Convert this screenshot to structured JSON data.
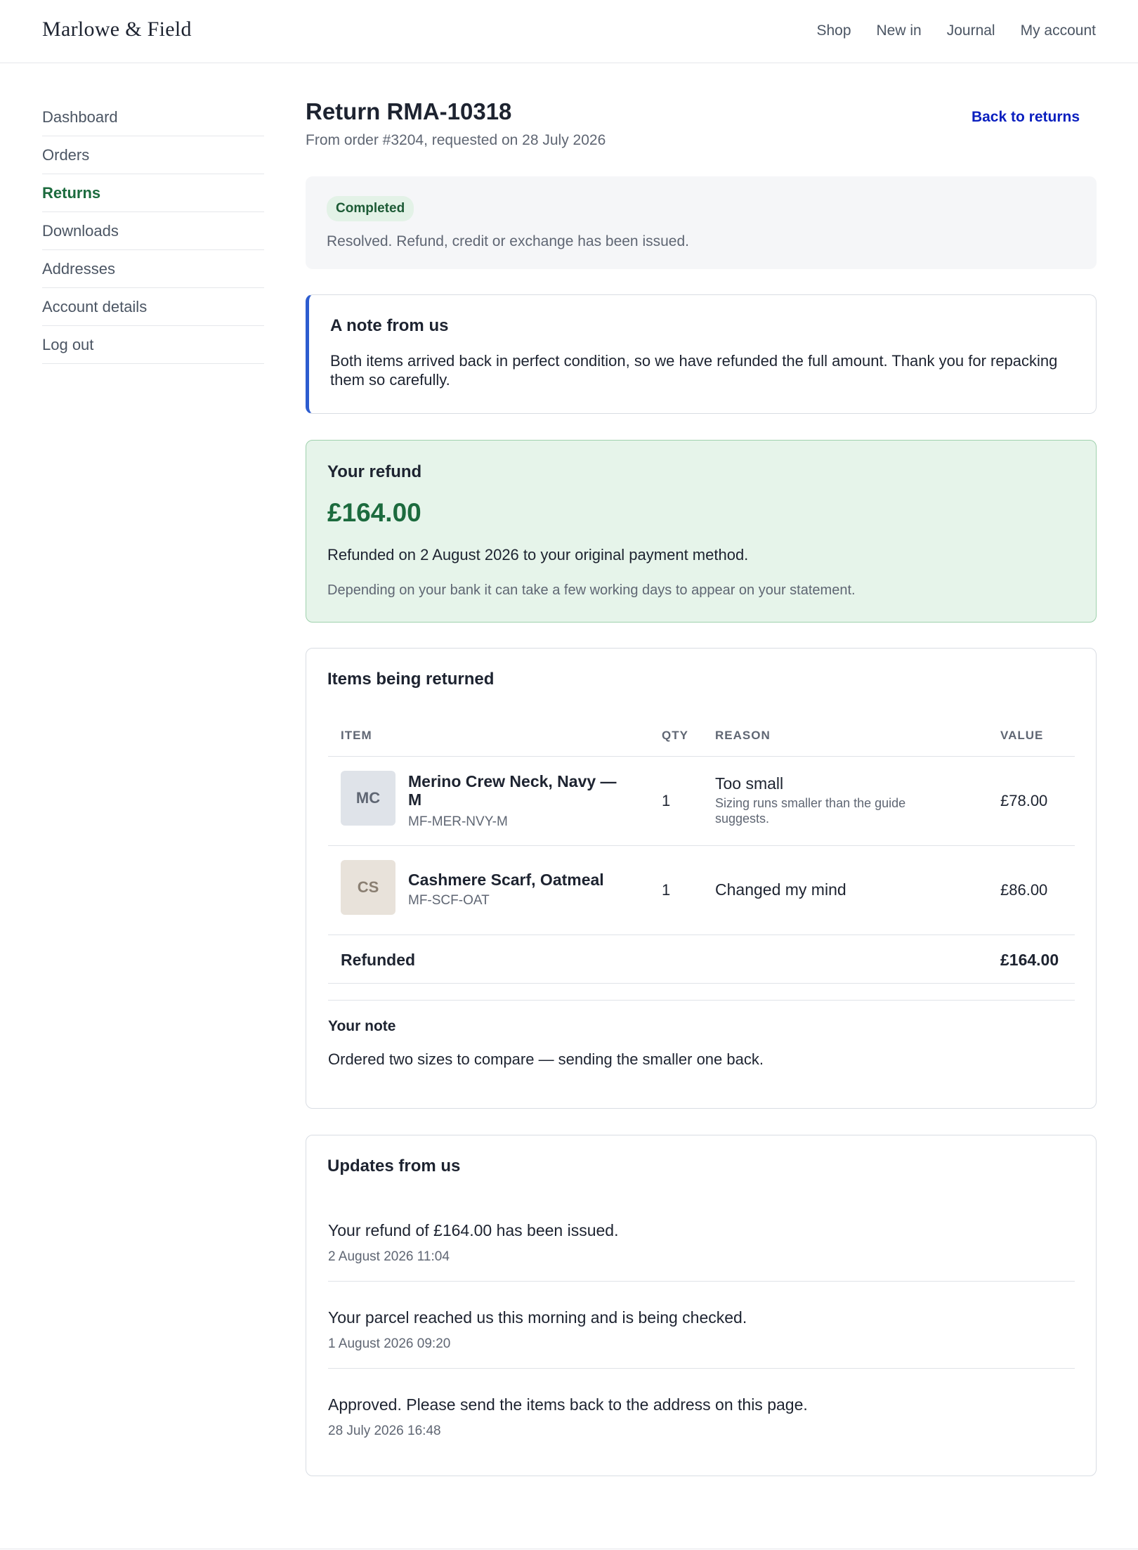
{
  "header": {
    "brand": "Marlowe & Field",
    "nav": [
      "Shop",
      "New in",
      "Journal",
      "My account"
    ]
  },
  "sidebar": {
    "items": [
      {
        "label": "Dashboard",
        "active": false
      },
      {
        "label": "Orders",
        "active": false
      },
      {
        "label": "Returns",
        "active": true
      },
      {
        "label": "Downloads",
        "active": false
      },
      {
        "label": "Addresses",
        "active": false
      },
      {
        "label": "Account details",
        "active": false
      },
      {
        "label": "Log out",
        "active": false
      }
    ]
  },
  "page": {
    "title": "Return RMA-10318",
    "subtitle": "From order #3204, requested on 28 July 2026",
    "back_label": "Back to returns"
  },
  "status": {
    "badge": "Completed",
    "text": "Resolved. Refund, credit or exchange has been issued.",
    "colors": {
      "badge_bg": "#e3f2e7",
      "badge_text": "#1c5a35"
    }
  },
  "note": {
    "title": "A note from us",
    "body": "Both items arrived back in perfect condition, so we have refunded the full amount. Thank you for repacking them so carefully."
  },
  "refund": {
    "title": "Your refund",
    "amount": "£164.00",
    "line": "Refunded on 2 August 2026 to your original payment method.",
    "hint": "Depending on your bank it can take a few working days to appear on your statement."
  },
  "items": {
    "title": "Items being returned",
    "columns": [
      "ITEM",
      "QTY",
      "REASON",
      "VALUE"
    ],
    "rows": [
      {
        "thumb": "MC",
        "name": "Merino Crew Neck, Navy — M",
        "sku": "MF-MER-NVY-M",
        "qty": "1",
        "reason": "Too small",
        "reason_detail": "Sizing runs smaller than the guide suggests.",
        "value": "£78.00"
      },
      {
        "thumb": "CS",
        "name": "Cashmere Scarf, Oatmeal",
        "sku": "MF-SCF-OAT",
        "qty": "1",
        "reason": "Changed my mind",
        "reason_detail": "",
        "value": "£86.00"
      }
    ],
    "total_label": "Refunded",
    "total_value": "£164.00",
    "your_note_title": "Your note",
    "your_note_body": "Ordered two sizes to compare — sending the smaller one back."
  },
  "updates": {
    "title": "Updates from us",
    "entries": [
      {
        "text": "Your refund of £164.00 has been issued.",
        "time": "2 August 2026 11:04"
      },
      {
        "text": "Your parcel reached us this morning and is being checked.",
        "time": "1 August 2026 09:20"
      },
      {
        "text": "Approved. Please send the items back to the address on this page.",
        "time": "28 July 2026 16:48"
      }
    ]
  }
}
